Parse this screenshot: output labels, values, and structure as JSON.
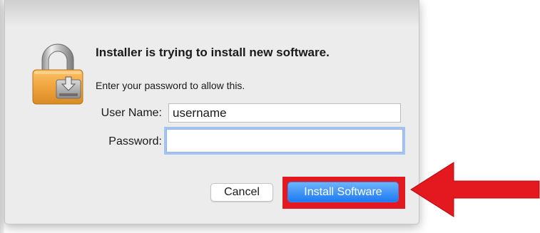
{
  "dialog": {
    "title": "Installer is trying to install new software.",
    "subtitle": "Enter your password to allow this.",
    "icon": "padlock-installer-icon"
  },
  "fields": {
    "user_name_label": "User Name:",
    "user_name_value": "username",
    "password_label": "Password:",
    "password_value": ""
  },
  "buttons": {
    "cancel_label": "Cancel",
    "install_label": "Install Software"
  },
  "annotation": {
    "arrow_icon": "red-arrow-left",
    "highlight_color": "#e4181f"
  },
  "colors": {
    "accent": "#1d7af4",
    "dialog_background": "#ececec",
    "focus_ring": "#a3c4f2"
  }
}
